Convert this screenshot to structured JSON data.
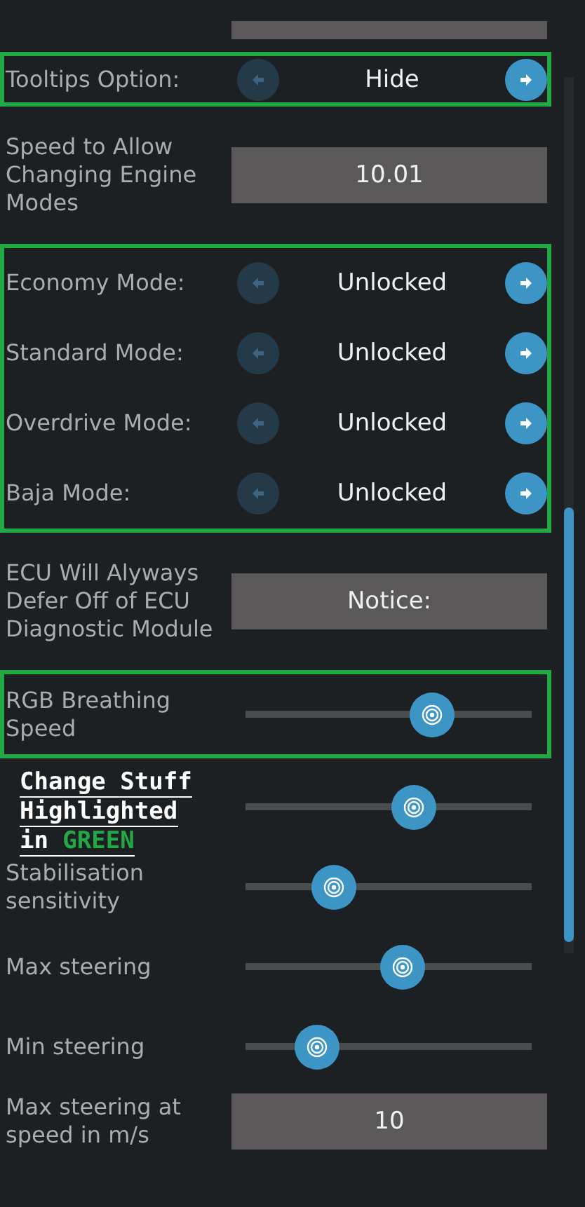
{
  "sections": [
    {
      "highlighted": false,
      "rows": [
        {
          "kind": "field"
        }
      ]
    },
    {
      "highlighted": true,
      "rows": [
        {
          "kind": "selector",
          "label": "Tooltips Option:",
          "value": "Hide",
          "prev_enabled": false,
          "next_enabled": true
        }
      ]
    },
    {
      "highlighted": false,
      "rows": [
        {
          "kind": "field",
          "label": "Speed to Allow Changing Engine Modes",
          "value": "10.01"
        }
      ]
    },
    {
      "highlighted": true,
      "rows": [
        {
          "kind": "selector",
          "label": "Economy Mode:",
          "value": "Unlocked",
          "prev_enabled": false,
          "next_enabled": true
        },
        {
          "kind": "selector",
          "label": "Standard Mode:",
          "value": "Unlocked",
          "prev_enabled": false,
          "next_enabled": true
        },
        {
          "kind": "selector",
          "label": "Overdrive Mode:",
          "value": "Unlocked",
          "prev_enabled": false,
          "next_enabled": true
        },
        {
          "kind": "selector",
          "label": "Baja Mode:",
          "value": "Unlocked",
          "prev_enabled": false,
          "next_enabled": true
        }
      ]
    },
    {
      "highlighted": false,
      "rows": [
        {
          "kind": "field",
          "label": "ECU Will Alyways Defer Off of ECU Diagnostic Module",
          "value": "Notice:"
        }
      ]
    },
    {
      "highlighted": true,
      "rows": [
        {
          "kind": "slider",
          "label": "RGB Breathing Speed"
        }
      ]
    },
    {
      "highlighted": false,
      "rows": [
        {
          "kind": "slider"
        },
        {
          "kind": "slider",
          "label": "Stabilisation sensitivity"
        },
        {
          "kind": "slider",
          "label": "Max steering"
        },
        {
          "kind": "slider",
          "label": "Min steering"
        },
        {
          "kind": "field",
          "label": "Max steering at speed in m/s",
          "value": "10"
        }
      ]
    }
  ],
  "annotation": {
    "lines": [
      "Change Stuff",
      "Highlighted",
      "in"
    ],
    "highlight": "GREEN"
  }
}
